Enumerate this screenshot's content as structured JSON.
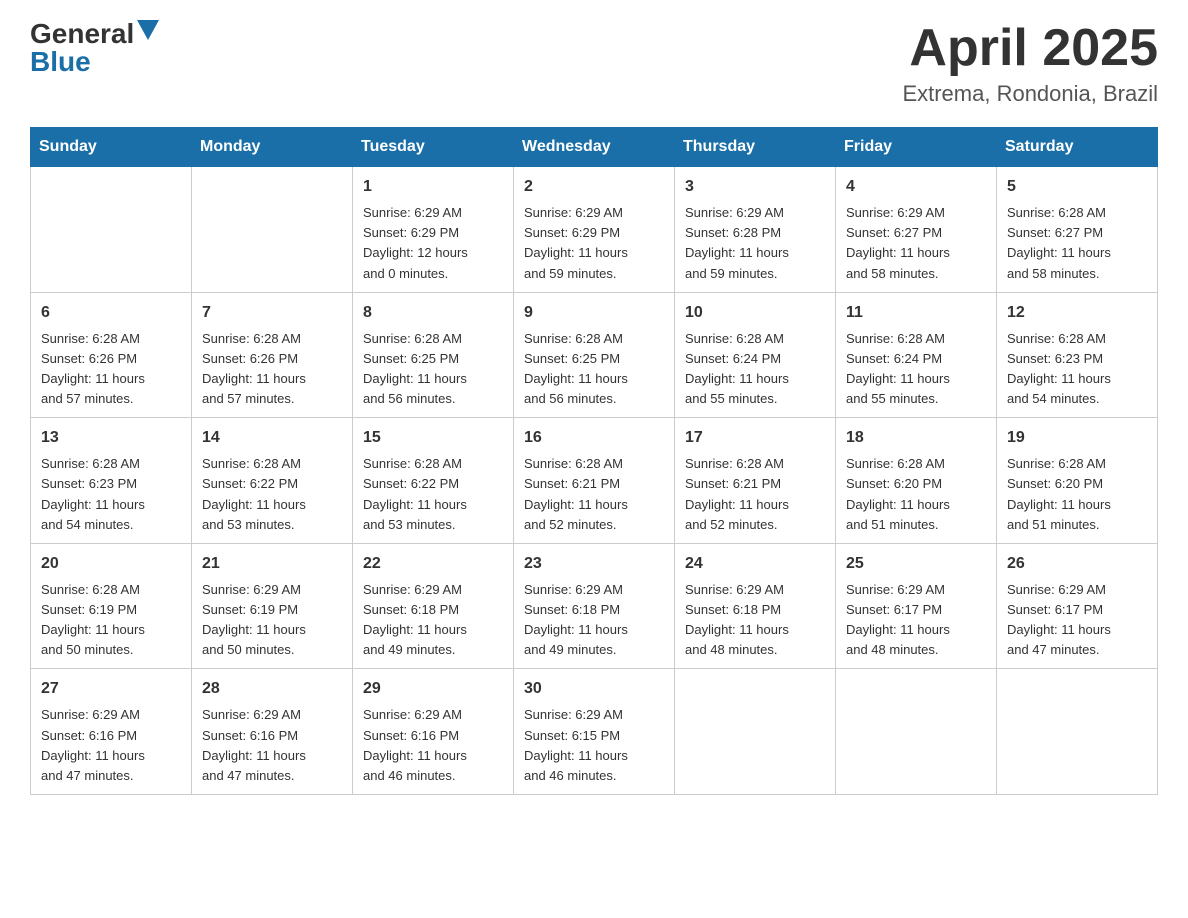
{
  "header": {
    "logo_general": "General",
    "logo_blue": "Blue",
    "month_title": "April 2025",
    "location": "Extrema, Rondonia, Brazil"
  },
  "weekdays": [
    "Sunday",
    "Monday",
    "Tuesday",
    "Wednesday",
    "Thursday",
    "Friday",
    "Saturday"
  ],
  "weeks": [
    [
      {
        "day": "",
        "info": ""
      },
      {
        "day": "",
        "info": ""
      },
      {
        "day": "1",
        "info": "Sunrise: 6:29 AM\nSunset: 6:29 PM\nDaylight: 12 hours\nand 0 minutes."
      },
      {
        "day": "2",
        "info": "Sunrise: 6:29 AM\nSunset: 6:29 PM\nDaylight: 11 hours\nand 59 minutes."
      },
      {
        "day": "3",
        "info": "Sunrise: 6:29 AM\nSunset: 6:28 PM\nDaylight: 11 hours\nand 59 minutes."
      },
      {
        "day": "4",
        "info": "Sunrise: 6:29 AM\nSunset: 6:27 PM\nDaylight: 11 hours\nand 58 minutes."
      },
      {
        "day": "5",
        "info": "Sunrise: 6:28 AM\nSunset: 6:27 PM\nDaylight: 11 hours\nand 58 minutes."
      }
    ],
    [
      {
        "day": "6",
        "info": "Sunrise: 6:28 AM\nSunset: 6:26 PM\nDaylight: 11 hours\nand 57 minutes."
      },
      {
        "day": "7",
        "info": "Sunrise: 6:28 AM\nSunset: 6:26 PM\nDaylight: 11 hours\nand 57 minutes."
      },
      {
        "day": "8",
        "info": "Sunrise: 6:28 AM\nSunset: 6:25 PM\nDaylight: 11 hours\nand 56 minutes."
      },
      {
        "day": "9",
        "info": "Sunrise: 6:28 AM\nSunset: 6:25 PM\nDaylight: 11 hours\nand 56 minutes."
      },
      {
        "day": "10",
        "info": "Sunrise: 6:28 AM\nSunset: 6:24 PM\nDaylight: 11 hours\nand 55 minutes."
      },
      {
        "day": "11",
        "info": "Sunrise: 6:28 AM\nSunset: 6:24 PM\nDaylight: 11 hours\nand 55 minutes."
      },
      {
        "day": "12",
        "info": "Sunrise: 6:28 AM\nSunset: 6:23 PM\nDaylight: 11 hours\nand 54 minutes."
      }
    ],
    [
      {
        "day": "13",
        "info": "Sunrise: 6:28 AM\nSunset: 6:23 PM\nDaylight: 11 hours\nand 54 minutes."
      },
      {
        "day": "14",
        "info": "Sunrise: 6:28 AM\nSunset: 6:22 PM\nDaylight: 11 hours\nand 53 minutes."
      },
      {
        "day": "15",
        "info": "Sunrise: 6:28 AM\nSunset: 6:22 PM\nDaylight: 11 hours\nand 53 minutes."
      },
      {
        "day": "16",
        "info": "Sunrise: 6:28 AM\nSunset: 6:21 PM\nDaylight: 11 hours\nand 52 minutes."
      },
      {
        "day": "17",
        "info": "Sunrise: 6:28 AM\nSunset: 6:21 PM\nDaylight: 11 hours\nand 52 minutes."
      },
      {
        "day": "18",
        "info": "Sunrise: 6:28 AM\nSunset: 6:20 PM\nDaylight: 11 hours\nand 51 minutes."
      },
      {
        "day": "19",
        "info": "Sunrise: 6:28 AM\nSunset: 6:20 PM\nDaylight: 11 hours\nand 51 minutes."
      }
    ],
    [
      {
        "day": "20",
        "info": "Sunrise: 6:28 AM\nSunset: 6:19 PM\nDaylight: 11 hours\nand 50 minutes."
      },
      {
        "day": "21",
        "info": "Sunrise: 6:29 AM\nSunset: 6:19 PM\nDaylight: 11 hours\nand 50 minutes."
      },
      {
        "day": "22",
        "info": "Sunrise: 6:29 AM\nSunset: 6:18 PM\nDaylight: 11 hours\nand 49 minutes."
      },
      {
        "day": "23",
        "info": "Sunrise: 6:29 AM\nSunset: 6:18 PM\nDaylight: 11 hours\nand 49 minutes."
      },
      {
        "day": "24",
        "info": "Sunrise: 6:29 AM\nSunset: 6:18 PM\nDaylight: 11 hours\nand 48 minutes."
      },
      {
        "day": "25",
        "info": "Sunrise: 6:29 AM\nSunset: 6:17 PM\nDaylight: 11 hours\nand 48 minutes."
      },
      {
        "day": "26",
        "info": "Sunrise: 6:29 AM\nSunset: 6:17 PM\nDaylight: 11 hours\nand 47 minutes."
      }
    ],
    [
      {
        "day": "27",
        "info": "Sunrise: 6:29 AM\nSunset: 6:16 PM\nDaylight: 11 hours\nand 47 minutes."
      },
      {
        "day": "28",
        "info": "Sunrise: 6:29 AM\nSunset: 6:16 PM\nDaylight: 11 hours\nand 47 minutes."
      },
      {
        "day": "29",
        "info": "Sunrise: 6:29 AM\nSunset: 6:16 PM\nDaylight: 11 hours\nand 46 minutes."
      },
      {
        "day": "30",
        "info": "Sunrise: 6:29 AM\nSunset: 6:15 PM\nDaylight: 11 hours\nand 46 minutes."
      },
      {
        "day": "",
        "info": ""
      },
      {
        "day": "",
        "info": ""
      },
      {
        "day": "",
        "info": ""
      }
    ]
  ]
}
